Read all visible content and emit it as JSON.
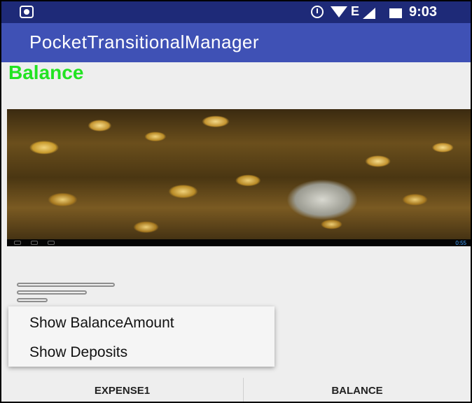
{
  "status_bar": {
    "network_type": "E",
    "time": "9:03",
    "icons": [
      "app-notification-icon",
      "alarm-icon",
      "wifi-icon",
      "signal-icon",
      "battery-icon"
    ]
  },
  "action_bar": {
    "title": "PocketTransitionalManager"
  },
  "content": {
    "heading": "Balance",
    "image_icon": "coins-image",
    "image_nav_time": "0:55"
  },
  "popup_menu": {
    "items": [
      {
        "label": "Show BalanceAmount"
      },
      {
        "label": "Show Deposits"
      }
    ]
  },
  "tabs": [
    {
      "label": "EXPENSE1"
    },
    {
      "label": "BALANCE"
    }
  ],
  "colors": {
    "status_bar": "#1e2a78",
    "action_bar": "#3f51b5",
    "heading": "#22e322",
    "background": "#eeeeee"
  }
}
